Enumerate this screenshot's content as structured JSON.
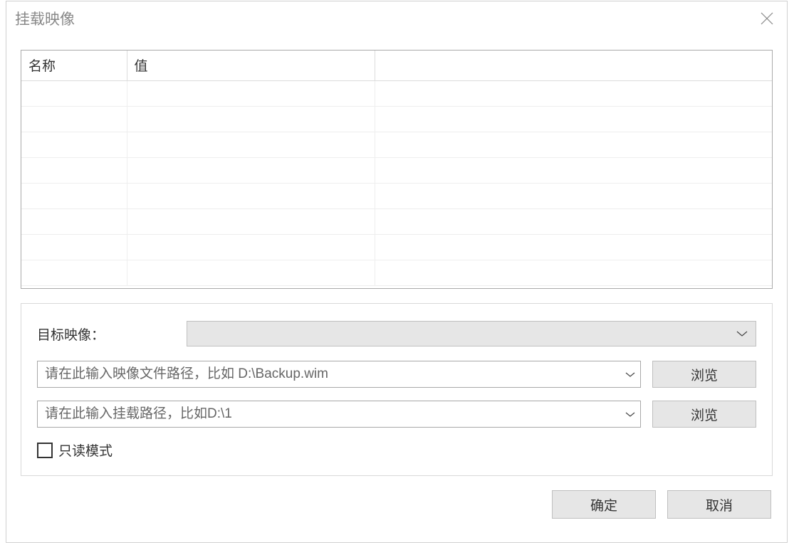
{
  "dialog": {
    "title": "挂载映像"
  },
  "table": {
    "headers": {
      "name": "名称",
      "value": "值"
    }
  },
  "form": {
    "target_label": "目标映像：",
    "image_path": {
      "placeholder": "请在此输入映像文件路径，比如 D:\\Backup.wim",
      "value": ""
    },
    "mount_path": {
      "placeholder": "请在此输入挂载路径，比如D:\\1",
      "value": ""
    },
    "browse_label": "浏览",
    "readonly_label": "只读模式",
    "readonly_checked": false
  },
  "buttons": {
    "ok": "确定",
    "cancel": "取消"
  }
}
